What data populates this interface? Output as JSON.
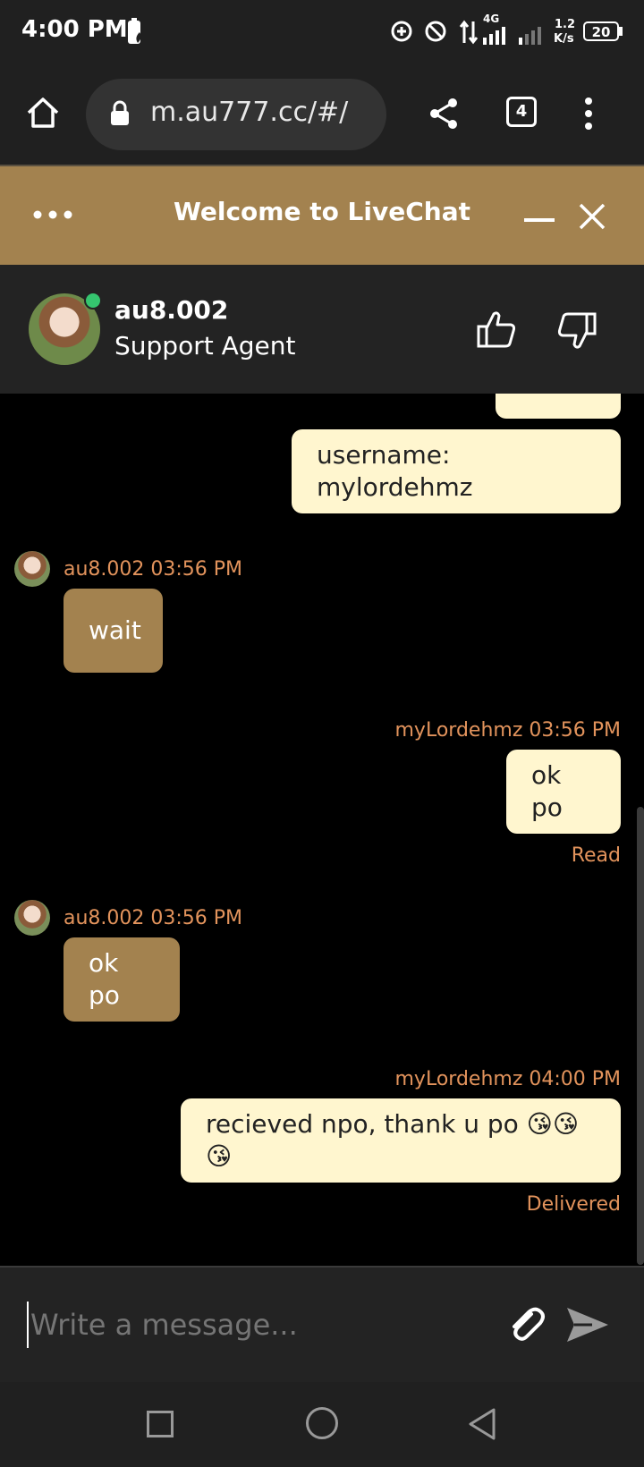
{
  "status_bar": {
    "time": "4:00 PM",
    "network": "4G",
    "speed_value": "1.2",
    "speed_unit": "K/s",
    "battery": "20"
  },
  "browser": {
    "url": "m.au777.cc/#/",
    "tab_count": "4"
  },
  "livechat": {
    "title": "Welcome to LiveChat",
    "agent_name": "au8.002",
    "agent_role": "Support Agent"
  },
  "messages": [
    {
      "side": "out",
      "text": "username: mylordehmz"
    },
    {
      "side": "in",
      "sender": "au8.002 03:56 PM",
      "text": "wait"
    },
    {
      "side": "out",
      "sender": "myLordehmz 03:56 PM",
      "text": "ok po",
      "status": "Read"
    },
    {
      "side": "in",
      "sender": "au8.002 03:56 PM",
      "text": "ok po"
    },
    {
      "side": "out",
      "sender": "myLordehmz 04:00 PM",
      "text": "recieved npo, thank u po 😘😘😘",
      "status": "Delivered"
    }
  ],
  "composer": {
    "placeholder": "Write a message..."
  },
  "colors": {
    "brand": "#a3824f",
    "outgoing_bubble": "#fff6cf",
    "meta_text": "#e2935c",
    "online": "#35c56f"
  }
}
